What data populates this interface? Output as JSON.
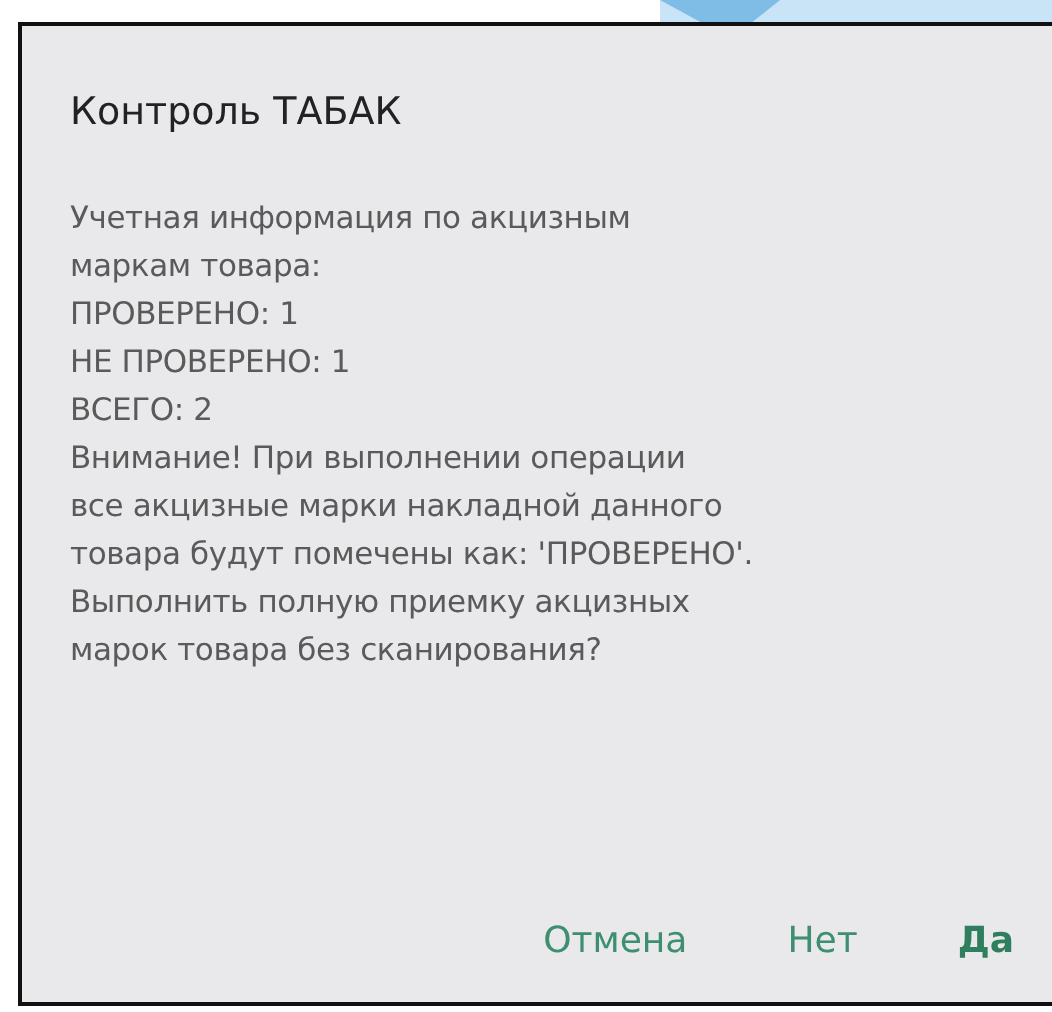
{
  "dialog": {
    "title": "Контроль ТАБАК",
    "message": [
      [
        "Учетная информация по акцизным",
        "маркам товара:"
      ],
      [
        "ПРОВЕРЕНО: 1"
      ],
      [
        "НЕ ПРОВЕРЕНО: 1"
      ],
      [
        "ВСЕГО: 2"
      ],
      [
        "Внимание! При выполнении операции",
        "все акцизные марки накладной данного",
        "товара будут помечены как: 'ПРОВЕРЕНО'.",
        "Выполнить полную приемку акцизных",
        "марок товара без сканирования?"
      ]
    ],
    "buttons": [
      {
        "label": "Отмена",
        "default": false
      },
      {
        "label": "Нет",
        "default": false
      },
      {
        "label": "Да",
        "default": true
      }
    ]
  }
}
